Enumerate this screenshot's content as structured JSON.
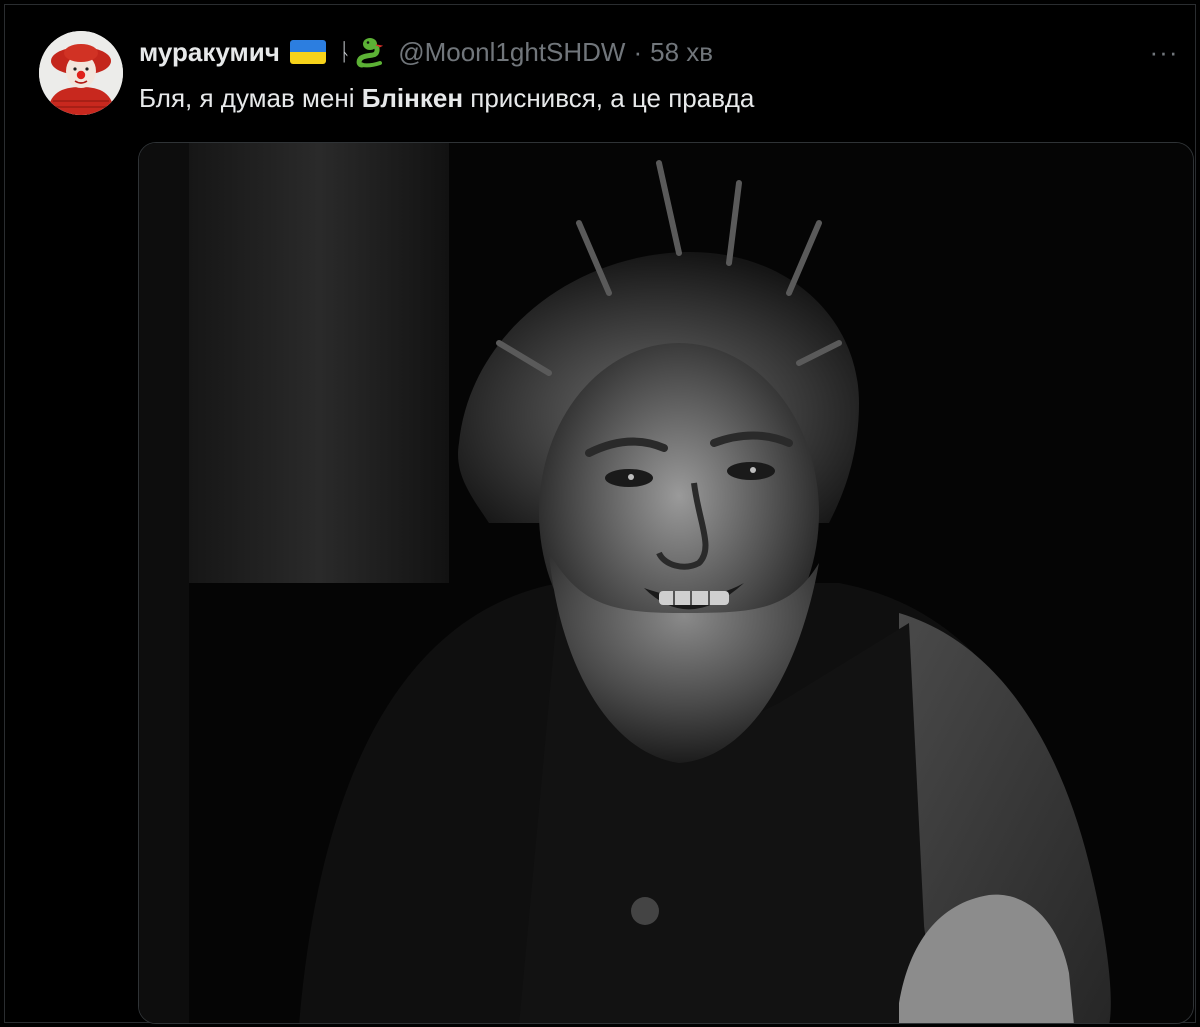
{
  "tweet": {
    "author": {
      "display_name": "муракумич",
      "badge_glyph": "ᚿ",
      "handle": "@Moonl1ghtSHDW",
      "flag_colors": [
        "#2c7ee0",
        "#f6d21a"
      ],
      "avatar_icon": "clown-avatar",
      "emoji_icon": "snake-emoji-icon"
    },
    "separator": "·",
    "timestamp": "58 хв",
    "more_label": "···",
    "text": {
      "before": "Бля, я думав мені ",
      "bold": "Блінкен",
      "after": " приснився, а це правда"
    },
    "media": {
      "kind": "photo",
      "style": "black-and-white"
    }
  },
  "colors": {
    "background": "#000000",
    "text_primary": "#e7e9ea",
    "text_secondary": "#71767b",
    "border": "#2f3336"
  }
}
